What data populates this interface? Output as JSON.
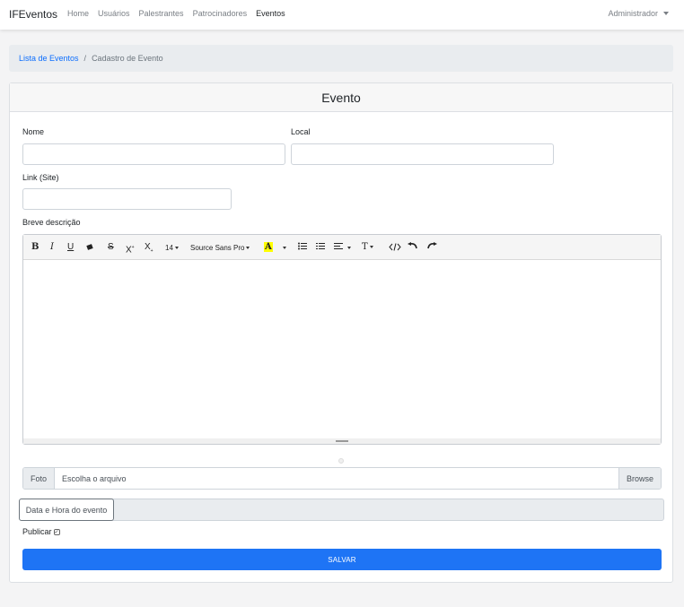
{
  "navbar": {
    "brand": "IFEventos",
    "links": [
      "Home",
      "Usuários",
      "Palestrantes",
      "Patrocinadores",
      "Eventos"
    ],
    "active_link": "Eventos",
    "user": "Administrador"
  },
  "breadcrumb": {
    "link": "Lista de Eventos",
    "separator": "/",
    "current": "Cadastro de Evento"
  },
  "form": {
    "title": "Evento",
    "nome_label": "Nome",
    "nome_value": "",
    "local_label": "Local",
    "local_value": "",
    "link_label": "Link (Site)",
    "link_value": "",
    "descricao_label": "Breve descrição",
    "editor_toolbar": {
      "bold": "B",
      "italic": "I",
      "underline": "U",
      "strikethrough": "S",
      "superscript": "X",
      "subscript": "X",
      "font_size": "14",
      "font_family": "Source Sans Pro",
      "color_letter": "A",
      "font_size_btn": "T"
    },
    "foto_label": "Foto",
    "file_placeholder": "Escolha o arquivo",
    "browse_label": "Browse",
    "date_label": "Data e Hora do evento",
    "publicar_label": "Publicar",
    "publicar_checked": true,
    "save_label": "SALVAR"
  },
  "colors": {
    "primary": "#1e74f5",
    "link": "#0d6efd",
    "background": "#f4f4f5",
    "editor_highlight": "#ffff00"
  }
}
